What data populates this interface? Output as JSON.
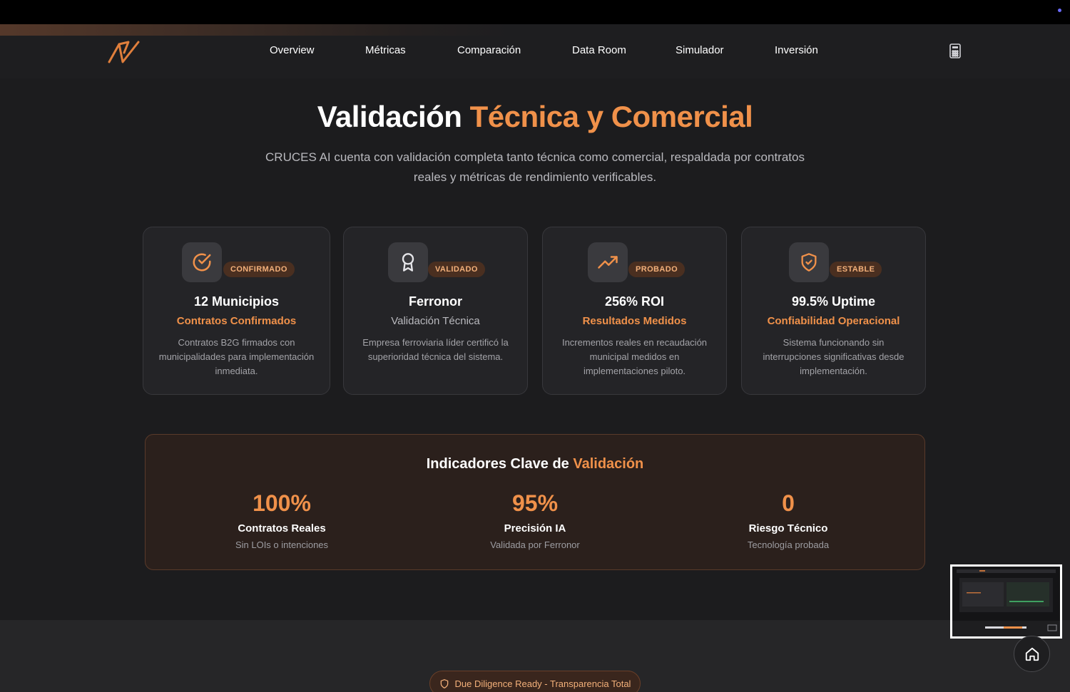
{
  "nav": {
    "links": [
      "Overview",
      "Métricas",
      "Comparación",
      "Data Room",
      "Simulador",
      "Inversión"
    ]
  },
  "hero": {
    "title_main": "Validación ",
    "title_accent": "Técnica y Comercial",
    "subtitle": "CRUCES AI cuenta con validación completa tanto técnica como comercial, respaldada por contratos reales y métricas de rendimiento verificables."
  },
  "cards": [
    {
      "icon": "check-circle-icon",
      "badge": "CONFIRMADO",
      "title": "12 Municipios",
      "subtitle": "Contratos Confirmados",
      "subtitle_color": "#f0914a",
      "description": "Contratos B2G firmados con municipalidades para implementación inmediata."
    },
    {
      "icon": "award-icon",
      "badge": "VALIDADO",
      "title": "Ferronor",
      "subtitle": "Validación Técnica",
      "subtitle_color": "#b9b9be",
      "description": "Empresa ferroviaria líder certificó la superioridad técnica del sistema."
    },
    {
      "icon": "trending-up-icon",
      "badge": "PROBADO",
      "title": "256% ROI",
      "subtitle": "Resultados Medidos",
      "subtitle_color": "#f0914a",
      "description": "Incrementos reales en recaudación municipal medidos en implementaciones piloto."
    },
    {
      "icon": "shield-check-icon",
      "badge": "ESTABLE",
      "title": "99.5% Uptime",
      "subtitle": "Confiabilidad Operacional",
      "subtitle_color": "#f0914a",
      "description": "Sistema funcionando sin interrupciones significativas desde implementación."
    }
  ],
  "kpis": {
    "title_main": "Indicadores Clave de ",
    "title_accent": "Validación",
    "items": [
      {
        "value": "100%",
        "label": "Contratos Reales",
        "sub": "Sin LOIs o intenciones"
      },
      {
        "value": "95%",
        "label": "Precisión IA",
        "sub": "Validada por Ferronor"
      },
      {
        "value": "0",
        "label": "Riesgo Técnico",
        "sub": "Tecnología probada"
      }
    ]
  },
  "due_diligence": {
    "label": "Due Diligence Ready - Transparencia Total",
    "icon": "shield-icon"
  },
  "colors": {
    "accent": "#f0914a",
    "background": "#1c1c1e",
    "card": "#242427"
  }
}
